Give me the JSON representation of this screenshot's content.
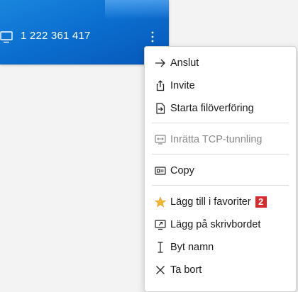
{
  "device": {
    "id_text": "1 222 361 417",
    "icons": {
      "device": "monitor-icon",
      "more": "more-vertical-icon"
    }
  },
  "menu": {
    "items": [
      {
        "label": "Anslut",
        "icon": "arrow-right-icon",
        "enabled": true
      },
      {
        "label": "Invite",
        "icon": "share-icon",
        "enabled": true
      },
      {
        "label": "Starta filöverföring",
        "icon": "file-transfer-icon",
        "enabled": true
      },
      {
        "label": "Inrätta TCP-tunnling",
        "icon": "tcp-tunnel-icon",
        "enabled": false
      },
      {
        "label": "Copy",
        "icon": "copy-id-icon",
        "enabled": true
      },
      {
        "label": "Lägg till i favoriter",
        "icon": "star-icon",
        "enabled": true,
        "badge": "2"
      },
      {
        "label": "Lägg på skrivbordet",
        "icon": "desktop-shortcut-icon",
        "enabled": true
      },
      {
        "label": "Byt namn",
        "icon": "text-cursor-icon",
        "enabled": true
      },
      {
        "label": "Ta bort",
        "icon": "close-icon",
        "enabled": true
      }
    ]
  },
  "colors": {
    "card_blue": "#0b6fd0",
    "star": "#f2b632",
    "badge": "#d62b2b",
    "disabled_text": "#8a8a8a"
  }
}
